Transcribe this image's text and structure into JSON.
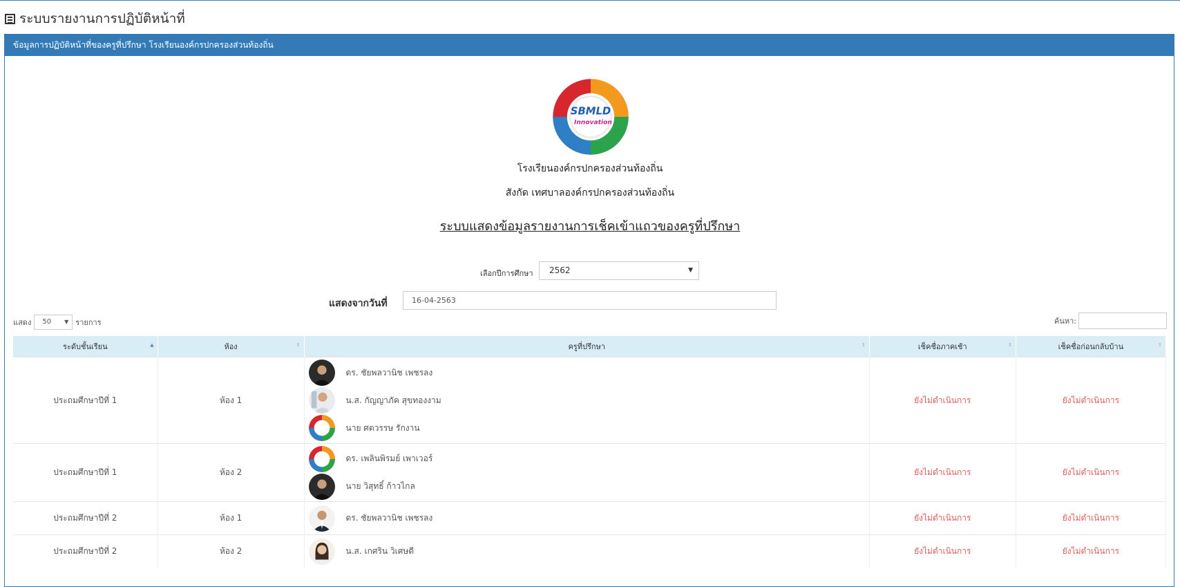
{
  "page": {
    "title": "ระบบรายงานการปฏิบัติหน้าที่"
  },
  "panel": {
    "heading": "ข้อมูลการปฏิบัติหน้าที่ของครูที่ปรึกษา โรงเรียนองค์กรปกครองส่วนท้องถิ่น"
  },
  "logo": {
    "line1": "SBMLD",
    "line2": "Innovation"
  },
  "header": {
    "school": "โรงเรียนองค์กรปกครองส่วนท้องถิ่น",
    "affiliation": "สังกัด เทศบาลองค์กรปกครองส่วนท้องถิ่น",
    "report_title": "ระบบแสดงข้อมูลรายงานการเช็คเข้าแถวของครูที่ปรึกษา"
  },
  "filters": {
    "year_label": "เลือกปีการศึกษา",
    "year_value": "2562",
    "date_label": "แสดงจากวันที่",
    "date_value": "16-04-2563"
  },
  "table_controls": {
    "show_label": "แสดง",
    "page_length": "50",
    "items_label": "รายการ",
    "search_label": "ค้นหา:"
  },
  "table": {
    "columns": [
      "ระดับชั้นเรียน",
      "ห้อง",
      "ครูที่ปรึกษา",
      "เช็คชื่อภาคเช้า",
      "เช็คชื่อก่อนกลับบ้าน"
    ],
    "rows": [
      {
        "level": "ประถมศึกษาปีที่ 1",
        "room": "ห้อง 1",
        "teachers": [
          {
            "name": "ดร. ชัยพลวานิช เพชรลง",
            "avatar": "photo-dark"
          },
          {
            "name": "น.ส. กัญญาภัค สุขทองงาม",
            "avatar": "photo-light"
          },
          {
            "name": "นาย ศตวรรษ รักงาน",
            "avatar": "sbmld-logo"
          }
        ],
        "morning": "ยังไม่ดำเนินการ",
        "evening": "ยังไม่ดำเนินการ"
      },
      {
        "level": "ประถมศึกษาปีที่ 1",
        "room": "ห้อง 2",
        "teachers": [
          {
            "name": "ดร. เพลินพิรมย์ เพาเวอร์",
            "avatar": "sbmld-logo"
          },
          {
            "name": "นาย วิสุทธิ์ ก้าวไกล",
            "avatar": "photo-dark"
          }
        ],
        "morning": "ยังไม่ดำเนินการ",
        "evening": "ยังไม่ดำเนินการ"
      },
      {
        "level": "ประถมศึกษาปีที่ 2",
        "room": "ห้อง 1",
        "teachers": [
          {
            "name": "ดร. ชัยพลวานิช เพชรลง",
            "avatar": "photo-suit"
          }
        ],
        "morning": "ยังไม่ดำเนินการ",
        "evening": "ยังไม่ดำเนินการ"
      },
      {
        "level": "ประถมศึกษาปีที่ 2",
        "room": "ห้อง 2",
        "teachers": [
          {
            "name": "น.ส. เกศริน วิเศษดี",
            "avatar": "photo-woman"
          }
        ],
        "morning": "ยังไม่ดำเนินการ",
        "evening": "ยังไม่ดำเนินการ"
      }
    ]
  },
  "colors": {
    "primary": "#337ab7",
    "table_header": "#d9edf7",
    "status": "#e05b5b"
  }
}
